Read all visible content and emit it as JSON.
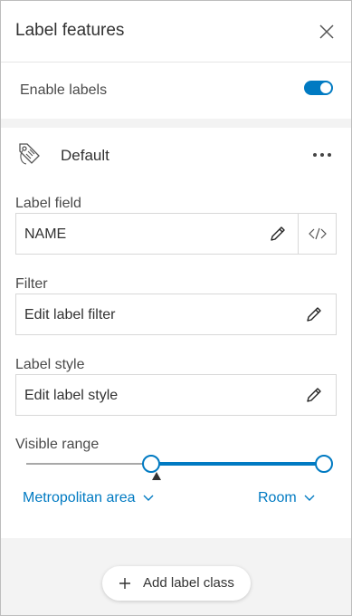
{
  "panel": {
    "title": "Label features",
    "close_icon": "close-icon"
  },
  "enable_labels": {
    "label": "Enable labels",
    "enabled": true,
    "accent_color": "#007ac2"
  },
  "label_class": {
    "name": "Default",
    "icon": "tag-icon",
    "more_icon": "more-icon",
    "label_field": {
      "label": "Label field",
      "value": "NAME",
      "edit_icon": "pencil-icon",
      "expression_icon": "code-icon"
    },
    "filter": {
      "label": "Filter",
      "value": "Edit label filter",
      "edit_icon": "pencil-icon"
    },
    "label_style": {
      "label": "Label style",
      "value": "Edit label style",
      "edit_icon": "pencil-icon"
    },
    "visible_range": {
      "label": "Visible range",
      "min_scale": "Metropolitan area",
      "max_scale": "Room"
    }
  },
  "add_class_button": {
    "label": "Add label class",
    "icon": "plus-icon"
  }
}
